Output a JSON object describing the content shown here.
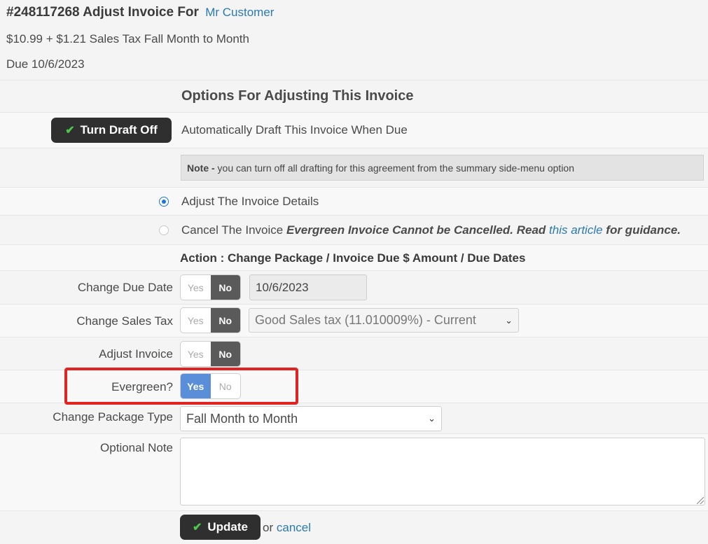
{
  "header": {
    "title_prefix": "#248117268 Adjust Invoice For",
    "customer_link": "Mr Customer",
    "subtitle": "$10.99 + $1.21 Sales Tax Fall Month to Month",
    "due": "Due 10/6/2023"
  },
  "options": {
    "section_title": "Options For Adjusting This Invoice",
    "draft_button": "Turn Draft Off",
    "draft_text": "Automatically Draft This Invoice When Due",
    "note_bold": "Note -",
    "note_text": " you can turn off all drafting for this agreement from the summary side-menu option",
    "radio_adjust": "Adjust The Invoice Details",
    "radio_cancel_label": "Cancel The Invoice",
    "cancel_warning_1": "Evergreen Invoice Cannot be Cancelled. Read",
    "cancel_link": "this article",
    "cancel_warning_2": "for guidance.",
    "action_title": "Action : Change Package / Invoice Due $ Amount / Due Dates"
  },
  "form": {
    "yes_label": "Yes",
    "no_label": "No",
    "change_due_date": {
      "label": "Change Due Date",
      "selected": "No",
      "value": "10/6/2023"
    },
    "change_sales_tax": {
      "label": "Change Sales Tax",
      "selected": "No",
      "value": "Good Sales tax (11.010009%) - Current"
    },
    "adjust_invoice": {
      "label": "Adjust Invoice",
      "selected": "No"
    },
    "evergreen": {
      "label": "Evergreen?",
      "selected": "Yes"
    },
    "change_package_type": {
      "label": "Change Package Type",
      "value": "Fall Month to Month"
    },
    "optional_note": {
      "label": "Optional Note",
      "value": ""
    },
    "update_button": "Update",
    "or_text": "or",
    "cancel_link": "cancel"
  },
  "colors": {
    "accent": "#5a8ed8",
    "link": "#2a7ab0",
    "highlight": "#e02424",
    "button_dark": "#2f2f2f"
  }
}
